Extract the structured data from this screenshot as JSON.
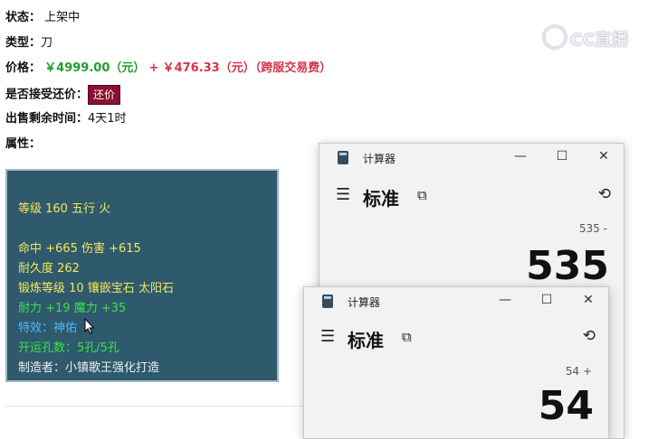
{
  "listing": {
    "status_label": "状态：",
    "status_value": "上架中",
    "type_label": "类型：",
    "type_value": "刀",
    "price_label": "价格：",
    "price_main": "￥4999.00（元）",
    "price_plus": "+",
    "price_fee": "￥476.33（元）（跨服交易费）",
    "bargain_label": "是否接受还价：",
    "bargain_button": "还价",
    "time_label": "出售剩余时间：",
    "time_value": "4天1时",
    "attr_label": "属性："
  },
  "attributes": [
    {
      "text": "等级 160 五行 火",
      "color": "#f3e85a"
    },
    {
      "text": "命中 +665 伤害 +615",
      "color": "#f3e85a"
    },
    {
      "text": "耐久度 262",
      "color": "#f3e85a"
    },
    {
      "text": "锻炼等级 10 镶嵌宝石 太阳石",
      "color": "#f3e85a"
    },
    {
      "text": "耐力 +19 魔力 +35",
      "color": "#3ee04a"
    },
    {
      "text": "特效：神佑",
      "color": "#4fb6ff"
    },
    {
      "text": "开运孔数：5孔/5孔",
      "color": "#3ee04a"
    },
    {
      "text": "制造者：小镇歌王强化打造",
      "color": "#f0f0f0"
    }
  ],
  "watermark": "CC直播",
  "calc_back": {
    "title": "计算器",
    "mode": "标准",
    "expression": "535 -",
    "result": "535"
  },
  "calc_front": {
    "title": "计算器",
    "mode": "标准",
    "expression": "54 +",
    "result": "54"
  }
}
